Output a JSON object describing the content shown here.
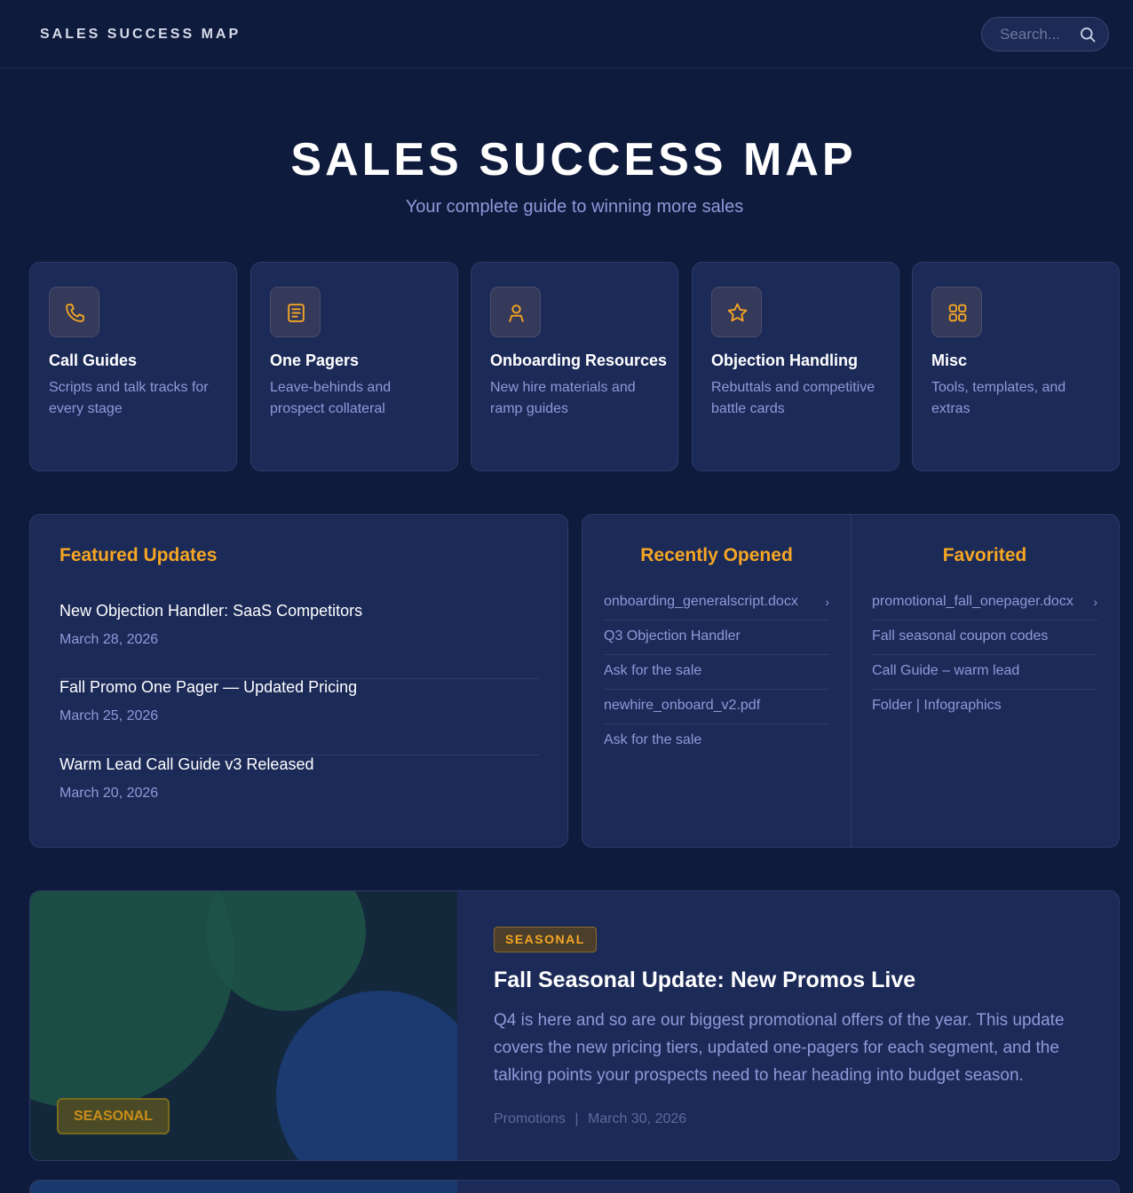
{
  "header": {
    "brand": "SALES SUCCESS MAP",
    "search_placeholder": "Search..."
  },
  "hero": {
    "title": "SALES SUCCESS MAP",
    "subtitle": "Your complete guide to winning more sales"
  },
  "categories": [
    {
      "icon": "phone-icon",
      "title": "Call Guides",
      "description": "Scripts and talk tracks for every stage"
    },
    {
      "icon": "document-icon",
      "title": "One Pagers",
      "description": "Leave-behinds and prospect collateral"
    },
    {
      "icon": "user-icon",
      "title": "Onboarding Resources",
      "description": "New hire materials and ramp guides"
    },
    {
      "icon": "star-icon",
      "title": "Objection Handling",
      "description": "Rebuttals and competitive battle cards"
    },
    {
      "icon": "grid-icon",
      "title": "Misc",
      "description": "Tools, templates, and extras"
    }
  ],
  "featured": {
    "title": "Featured Updates",
    "items": [
      {
        "title": "New Objection Handler: SaaS Competitors",
        "date": "March 28, 2026"
      },
      {
        "title": "Fall Promo One Pager — Updated Pricing",
        "date": "March 25, 2026"
      },
      {
        "title": "Warm Lead Call Guide v3 Released",
        "date": "March 20, 2026"
      }
    ]
  },
  "recent": {
    "title": "Recently Opened",
    "items": [
      "onboarding_generalscript.docx",
      "Q3 Objection Handler",
      "Ask for the sale",
      "newhire_onboard_v2.pdf",
      "Ask for the sale"
    ]
  },
  "favorites": {
    "title": "Favorited",
    "items": [
      "promotional_fall_onepager.docx",
      "Fall seasonal coupon codes",
      "Call Guide – warm lead",
      "Folder | Infographics"
    ]
  },
  "promo": {
    "image_badge": "SEASONAL",
    "tag": "SEASONAL",
    "title": "Fall Seasonal Update: New Promos Live",
    "body": "Q4 is here and so are our biggest promotional offers of the year. This update covers the new pricing tiers, updated one-pagers for each segment, and the talking points your prospects need to hear heading into budget season.",
    "category": "Promotions",
    "separator": "|",
    "date": "March 30, 2026"
  },
  "colors": {
    "background": "#0f1b3d",
    "card": "#1c2a58",
    "accent": "#f5a623",
    "muted_text": "#8e99d8"
  }
}
